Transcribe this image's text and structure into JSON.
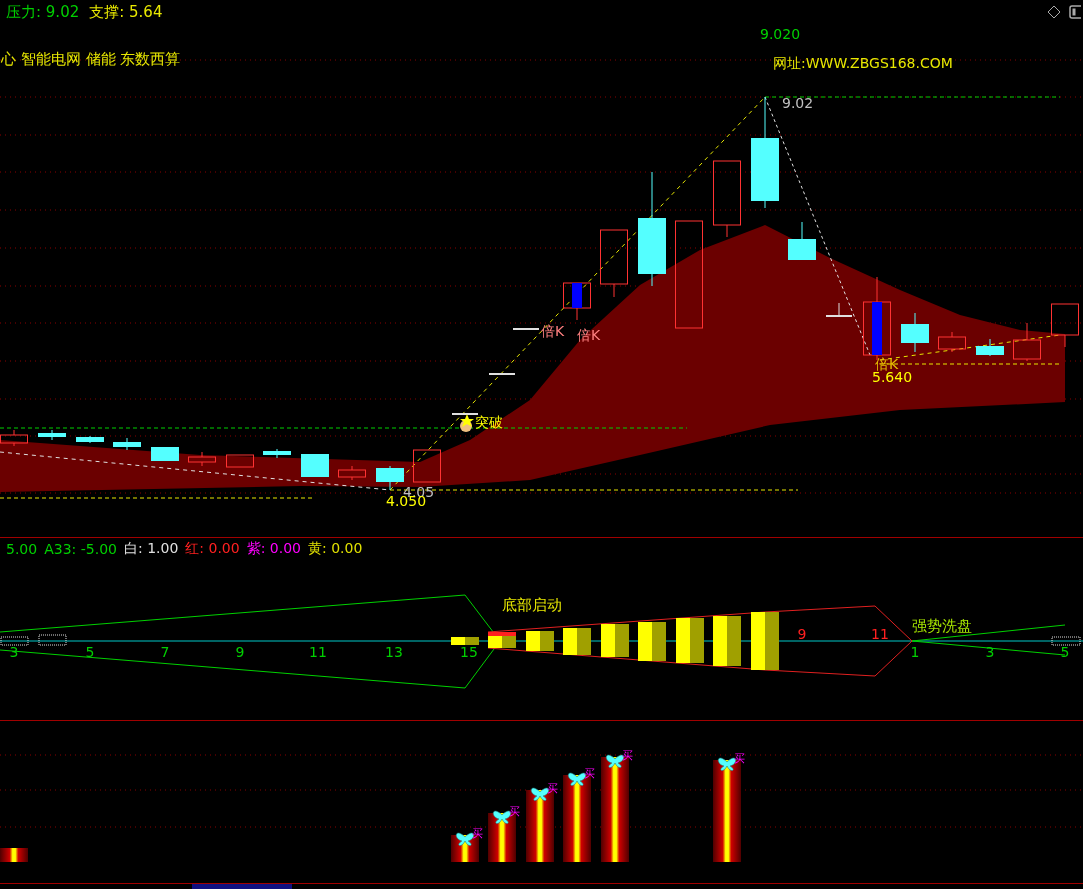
{
  "header": {
    "pressure": "压力: 9.02",
    "support": "支撑: 5.64"
  },
  "main_chart": {
    "sector_tags": "心 智能电网 储能 东数西算",
    "peak_label": "9.020",
    "website": "网址:WWW.ZBGS168.COM",
    "annotations": [
      {
        "text": "9.02",
        "color": "#c0c0c0"
      },
      {
        "text": "倍K",
        "color": "#ff8080"
      },
      {
        "text": "倍K",
        "color": "#ff8080"
      },
      {
        "text": "突破",
        "color": "#ffff00"
      },
      {
        "text": "4.05",
        "color": "#c0c0c0"
      },
      {
        "text": "4.050",
        "color": "#ffff00"
      },
      {
        "text": "倍K",
        "color": "#e8c000"
      },
      {
        "text": "5.640",
        "color": "#ffff00"
      }
    ]
  },
  "indicator_legend": [
    {
      "text": "5.00",
      "color": "#00d000"
    },
    {
      "text": "A33: -5.00",
      "color": "#00d000"
    },
    {
      "text": "白: 1.00",
      "color": "#e0e0e0"
    },
    {
      "text": "红: 0.00",
      "color": "#ff2020"
    },
    {
      "text": "紫: 0.00",
      "color": "#ff00ff"
    },
    {
      "text": "黄: 0.00",
      "color": "#e0e000"
    }
  ],
  "oscillator": {
    "labels": [
      "底部启动",
      "强势洗盘"
    ],
    "counts": [
      {
        "text": "3",
        "color": "#00d000"
      },
      {
        "text": "5",
        "color": "#00d000"
      },
      {
        "text": "7",
        "color": "#00d000"
      },
      {
        "text": "9",
        "color": "#00d000"
      },
      {
        "text": "11",
        "color": "#00d000"
      },
      {
        "text": "13",
        "color": "#00d000"
      },
      {
        "text": "15",
        "color": "#00d000"
      },
      {
        "text": "9",
        "color": "#ff2020"
      },
      {
        "text": "11",
        "color": "#ff2020"
      },
      {
        "text": "1",
        "color": "#00d000"
      },
      {
        "text": "3",
        "color": "#00d000"
      },
      {
        "text": "5",
        "color": "#00d000"
      }
    ]
  },
  "signal_bars": {
    "labels": [
      "买",
      "买",
      "买",
      "买",
      "买",
      "买"
    ]
  }
}
